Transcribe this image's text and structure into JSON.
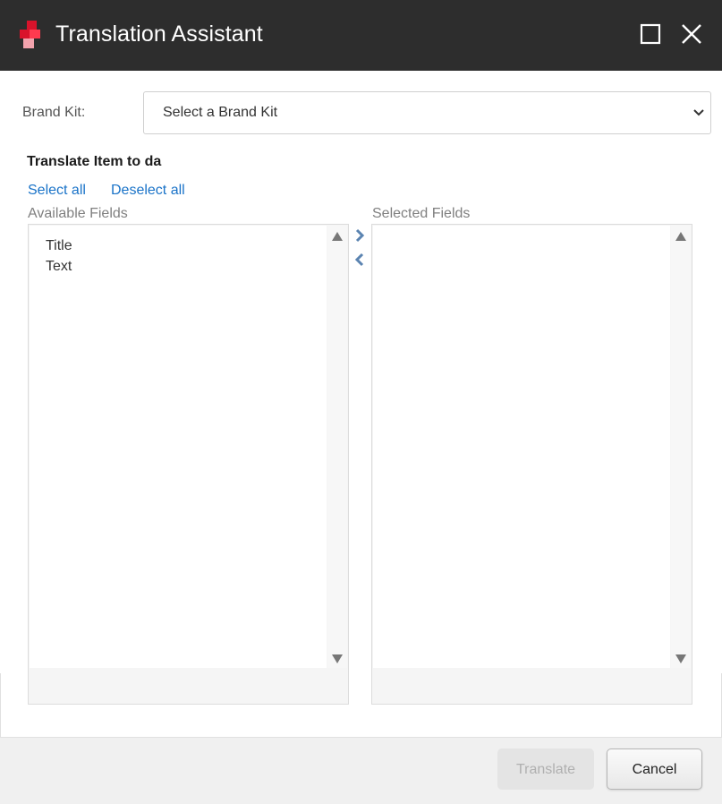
{
  "window": {
    "title": "Translation Assistant",
    "logo_icon": "app-logo-icon",
    "maximize_icon": "maximize-icon",
    "close_icon": "close-icon"
  },
  "brand_kit": {
    "label": "Brand Kit:",
    "selected_value": "Select a Brand Kit",
    "dropdown_icon": "chevron-down-icon"
  },
  "translate": {
    "heading": "Translate Item to da",
    "select_all": "Select all",
    "deselect_all": "Deselect all"
  },
  "available_fields": {
    "label": "Available Fields",
    "items": [
      "Title",
      "Text"
    ]
  },
  "selected_fields": {
    "label": "Selected Fields",
    "items": []
  },
  "move_buttons": {
    "add_icon": "chevron-right-icon",
    "remove_icon": "chevron-left-icon"
  },
  "footer": {
    "translate_label": "Translate",
    "translate_enabled": false,
    "cancel_label": "Cancel"
  },
  "colors": {
    "titlebar": "#2d2d2d",
    "link": "#1a73c8",
    "logo_red": "#d9132b",
    "arrow_blue": "#5b84b1"
  }
}
